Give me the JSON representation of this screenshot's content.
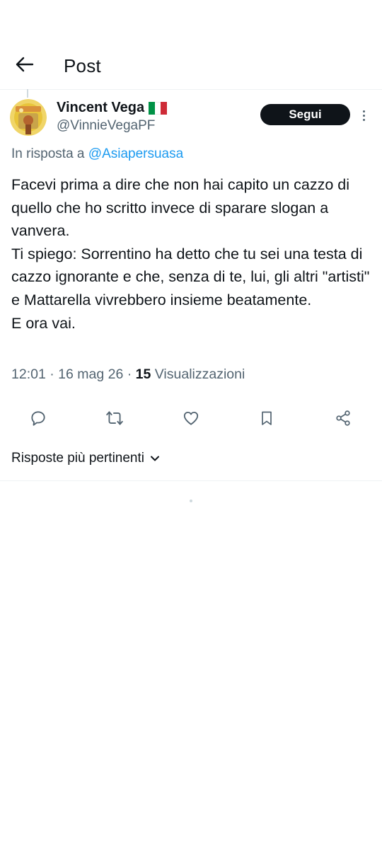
{
  "header": {
    "title": "Post",
    "back_icon": "arrow-left-icon"
  },
  "tweet": {
    "author": {
      "display_name": "Vincent Vega",
      "handle": "@VinnieVegaPF",
      "flag_icon": "italy-flag-icon"
    },
    "follow_label": "Segui",
    "reply_prefix": "In risposta a",
    "reply_to_handle": "@Asiapersuasa",
    "text": "Facevi prima a dire che non hai capito un cazzo di quello che ho scritto invece di sparare slogan a vanvera.\nTi spiego: Sorrentino ha detto che tu sei una testa di cazzo ignorante e che, senza di te, lui, gli altri \"artisti\" e Mattarella vivrebbero insieme beatamente.\nE ora vai.",
    "time": "12:01",
    "date": "16 mag 26",
    "separator": "·",
    "views_count": "15",
    "views_label": "Visualizzazioni"
  },
  "actions": [
    {
      "name": "reply-icon"
    },
    {
      "name": "repost-icon"
    },
    {
      "name": "like-icon"
    },
    {
      "name": "bookmark-icon"
    },
    {
      "name": "share-icon"
    }
  ],
  "replies_sort": {
    "label": "Risposte più pertinenti"
  },
  "colors": {
    "text": "#0f1419",
    "secondary": "#536471",
    "link": "#1d9bf0",
    "divider": "#eff3f4",
    "button_bg": "#0f1419"
  }
}
